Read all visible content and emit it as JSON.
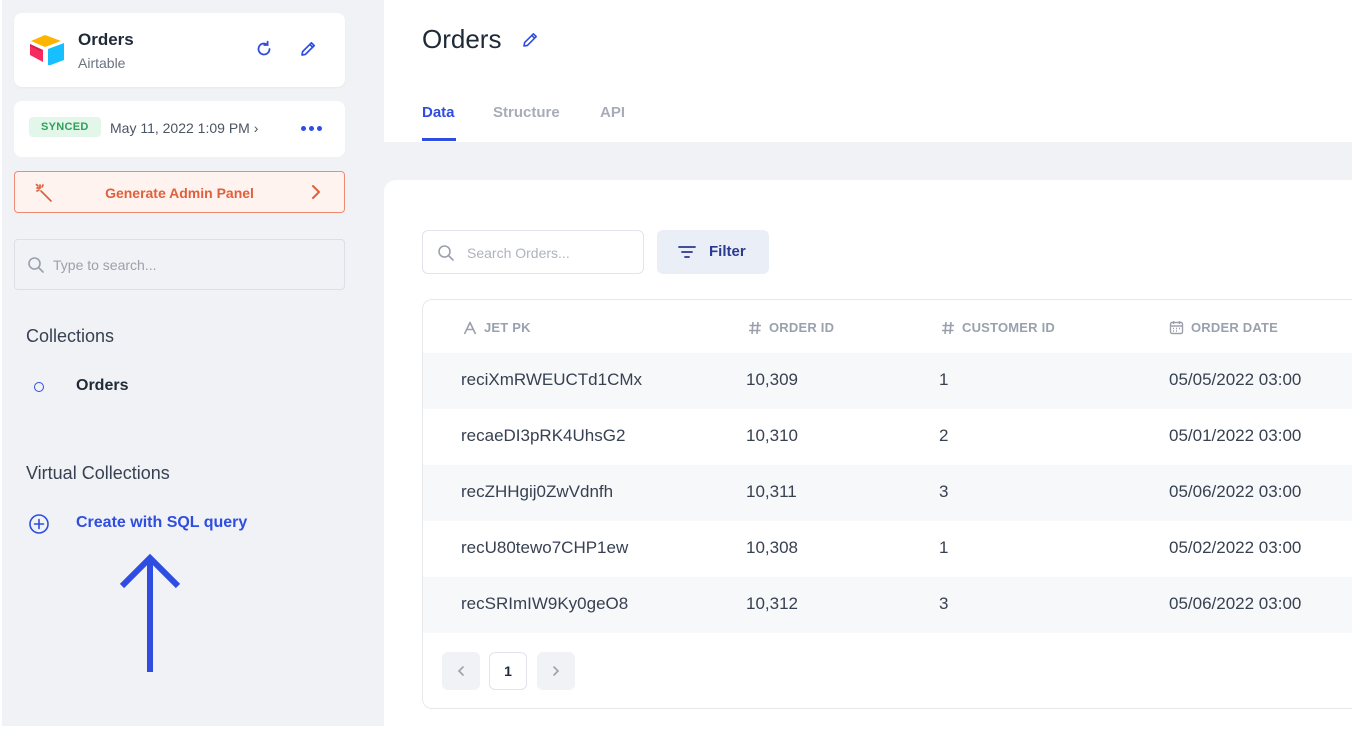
{
  "sidebar": {
    "connection": {
      "title": "Orders",
      "subtitle": "Airtable"
    },
    "sync": {
      "badge": "SYNCED",
      "time": "May 11, 2022 1:09 PM ›"
    },
    "generate_label": "Generate Admin Panel",
    "search_placeholder": "Type to search...",
    "collections_title": "Collections",
    "collections": [
      {
        "label": "Orders"
      }
    ],
    "virtual_title": "Virtual Collections",
    "create_label": "Create with SQL query"
  },
  "header": {
    "title": "Orders",
    "tabs": [
      {
        "label": "Data"
      },
      {
        "label": "Structure"
      },
      {
        "label": "API"
      }
    ],
    "active_tab": "Data"
  },
  "toolbar": {
    "search_placeholder": "Search Orders...",
    "filter_label": "Filter"
  },
  "table": {
    "columns": [
      {
        "label": "JET PK",
        "icon": "text-type-icon"
      },
      {
        "label": "ORDER ID",
        "icon": "hash-icon"
      },
      {
        "label": "CUSTOMER ID",
        "icon": "hash-icon"
      },
      {
        "label": "ORDER DATE",
        "icon": "calendar-icon"
      }
    ],
    "rows": [
      {
        "jet_pk": "reciXmRWEUCTd1CMx",
        "order_id": "10,309",
        "customer_id": "1",
        "order_date": "05/05/2022 03:00"
      },
      {
        "jet_pk": "recaeDI3pRK4UhsG2",
        "order_id": "10,310",
        "customer_id": "2",
        "order_date": "05/01/2022 03:00"
      },
      {
        "jet_pk": "recZHHgij0ZwVdnfh",
        "order_id": "10,311",
        "customer_id": "3",
        "order_date": "05/06/2022 03:00"
      },
      {
        "jet_pk": "recU80tewo7CHP1ew",
        "order_id": "10,308",
        "customer_id": "1",
        "order_date": "05/02/2022 03:00"
      },
      {
        "jet_pk": "recSRImIW9Ky0geO8",
        "order_id": "10,312",
        "customer_id": "3",
        "order_date": "05/06/2022 03:00"
      }
    ]
  },
  "pagination": {
    "current_page": "1"
  },
  "colors": {
    "accent": "#2f4de0",
    "synced": "#2ea05a",
    "generate": "#e0603d"
  }
}
